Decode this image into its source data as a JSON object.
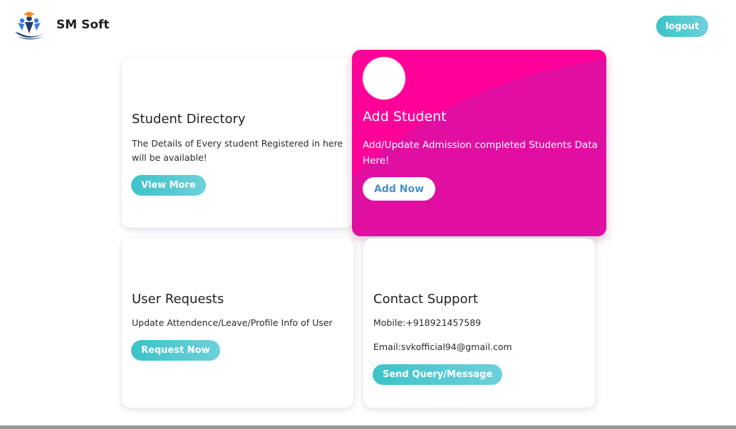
{
  "header": {
    "brand": "SM Soft",
    "logout_label": "logout",
    "logo_icon": "graduation-people-logo"
  },
  "cards": {
    "directory": {
      "title": "Student Directory",
      "text": "The Details of Every student Registered in here will be available!",
      "button": "View More"
    },
    "add_student": {
      "title": "Add Student",
      "text": "Add/Update Admission completed Students Data Here!",
      "button": "Add Now",
      "background": "#ff0099"
    },
    "requests": {
      "title": "User Requests",
      "text": "Update Attendence/Leave/Profile Info of User",
      "button": "Request Now"
    },
    "support": {
      "title": "Contact Support",
      "mobile": "Mobile:+918921457589",
      "email": "Email:svkofficial94@gmail.com",
      "button": "Send Query/Message"
    }
  },
  "colors": {
    "accent_teal": "#3cc3c8",
    "accent_pink": "#ff0099",
    "add_now_text": "#4a90c8"
  }
}
